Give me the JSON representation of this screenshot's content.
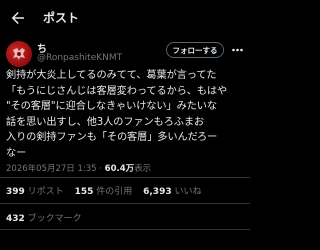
{
  "header": {
    "title": "ポスト",
    "back_icon": "arrow-left-icon"
  },
  "author": {
    "display_name": "ち",
    "handle": "@RonpashiteKNMT",
    "avatar_color": "#c21f1f"
  },
  "follow_button": {
    "label": "フォローする"
  },
  "more_icon": "more-dots-icon",
  "post": {
    "lines": [
      "剣持が大炎上してるのみてて、葛葉が言ってた",
      "「もうにじさんじは客層変わってるから、もはや",
      "\"その客層\"に迎合しなきゃいけない」みたいな",
      "話を思い出すし、他3人のファンもろふまお",
      "入りの剣持ファンも「その客層」多いんだろー",
      "なー"
    ],
    "timestamp": "2026年05月27日 1:35",
    "separator": "·",
    "views_count": "60.4万",
    "views_label": "表示"
  },
  "stats": {
    "reposts_count": "399",
    "reposts_label": "リポスト",
    "quotes_count": "155",
    "quotes_label": "件の引用",
    "likes_count": "6,393",
    "likes_label": "いいね",
    "bookmarks_count": "432",
    "bookmarks_label": "ブックマーク"
  },
  "colors": {
    "background": "#000000",
    "text_primary": "#e7e9ea",
    "text_secondary": "#71767b",
    "divider": "#2f3336",
    "button_border": "#536471"
  }
}
